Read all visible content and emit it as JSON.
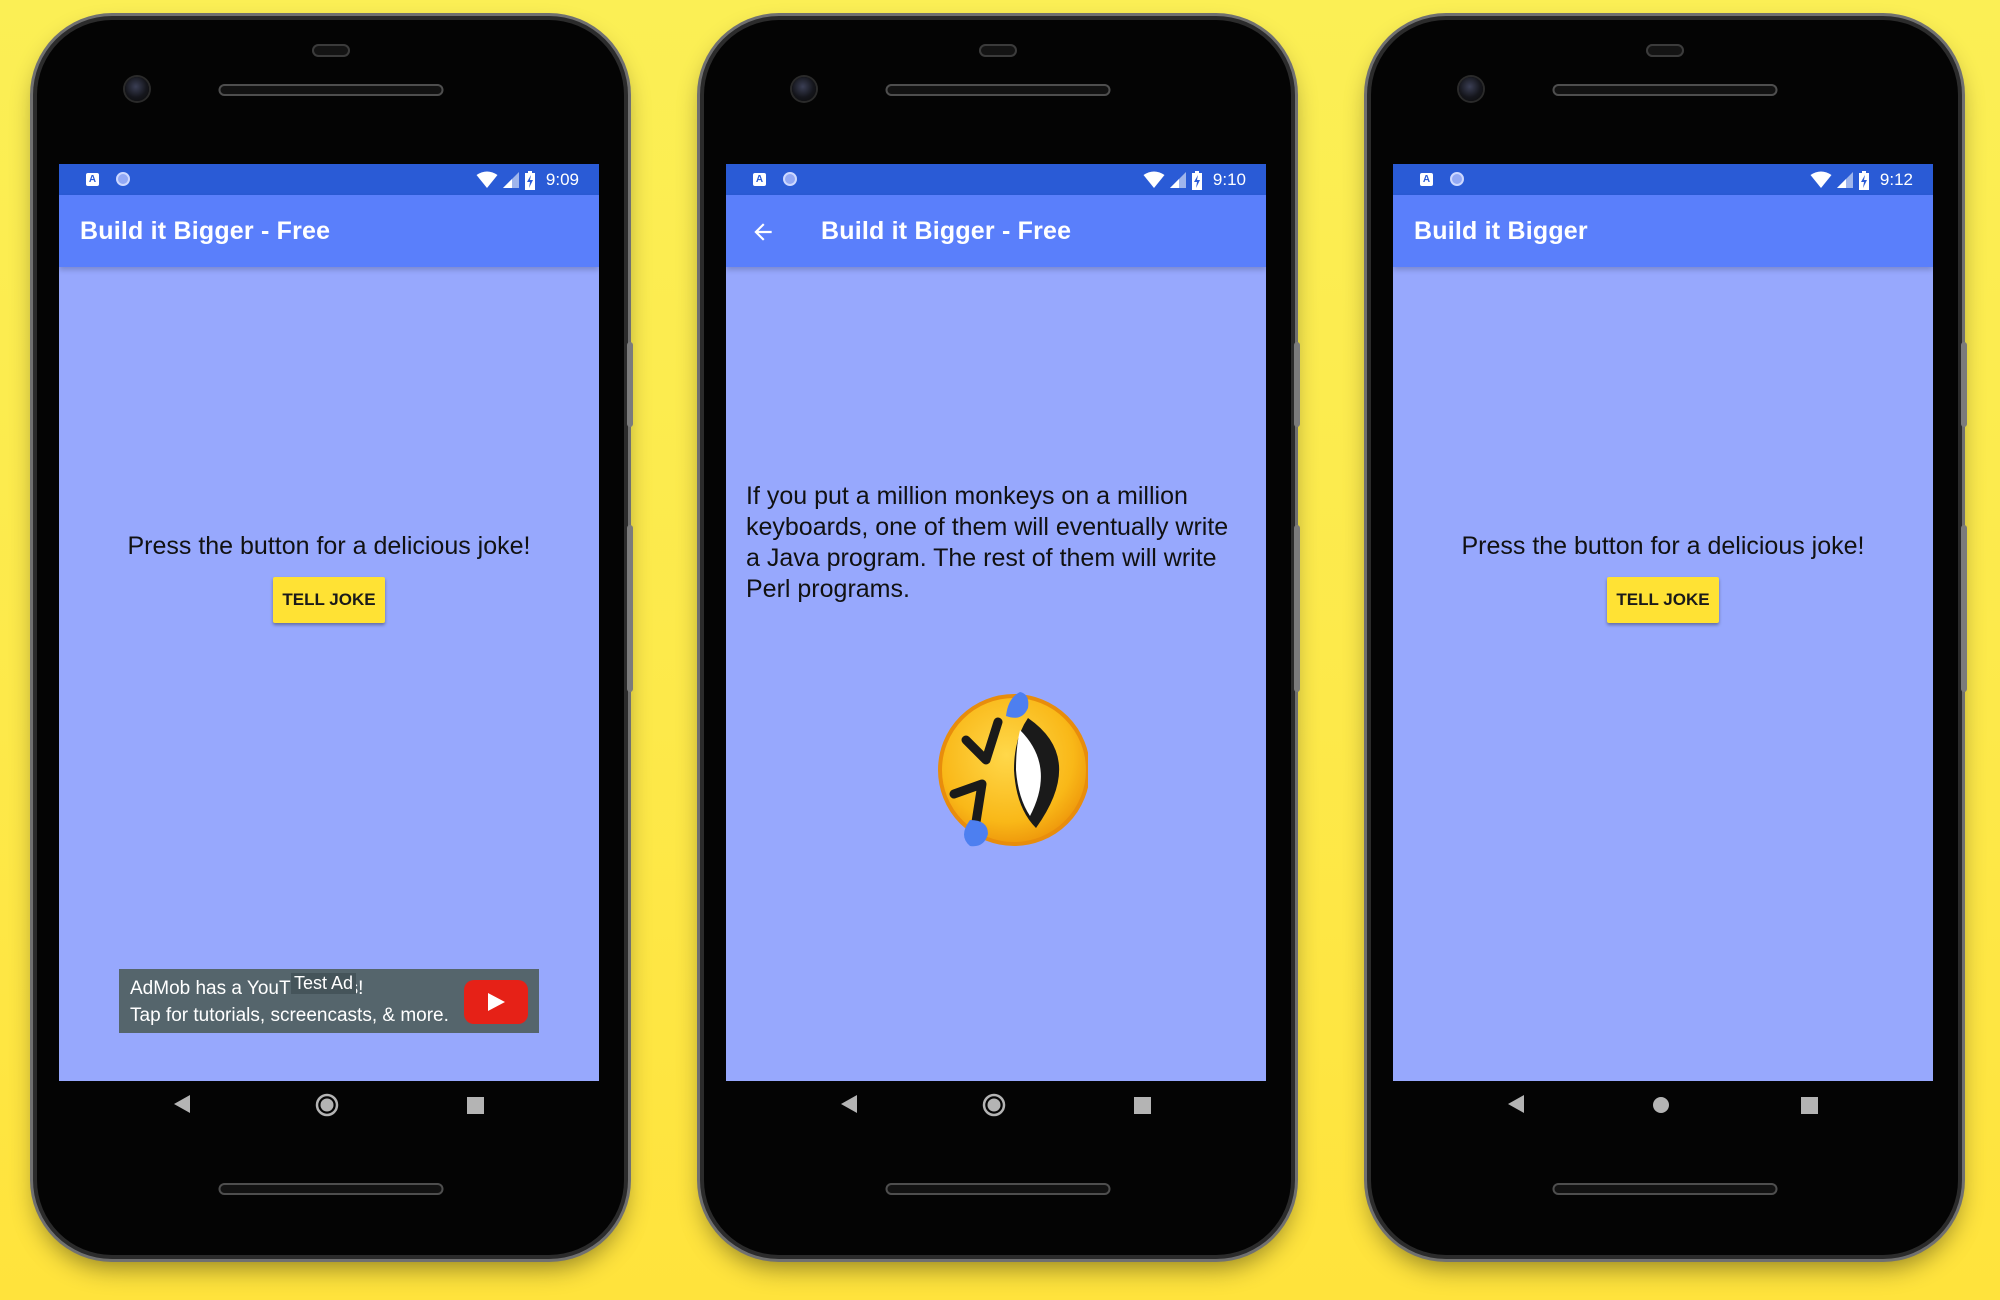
{
  "phones": [
    {
      "status": {
        "time": "9:09",
        "notif_icon": "A"
      },
      "appbar": {
        "title": "Build it Bigger - Free",
        "has_back": false
      },
      "main": {
        "prompt": "Press the button for a delicious joke!",
        "button_label": "TELL JOKE"
      },
      "ad": {
        "line1": "AdMob has a YouTube series!",
        "line1_visible_start": "AdMob has a YouT",
        "line1_visible_end": "s!",
        "line2": "Tap for tutorials, screencasts, & more.",
        "badge": "Test Ad"
      }
    },
    {
      "status": {
        "time": "9:10",
        "notif_icon": "A"
      },
      "appbar": {
        "title": "Build it Bigger - Free",
        "has_back": true
      },
      "main": {
        "joke": "If you put a million monkeys on a million keyboards, one of them will eventually write a Java program. The rest of them will write Perl programs.",
        "emoji": "rolling-on-floor-laughing-emoji"
      }
    },
    {
      "status": {
        "time": "9:12",
        "notif_icon": "A"
      },
      "appbar": {
        "title": "Build it Bigger",
        "has_back": false
      },
      "main": {
        "prompt": "Press the button for a delicious joke!",
        "button_label": "TELL JOKE"
      }
    }
  ],
  "colors": {
    "background": "#fde94a",
    "status_bar": "#2a5bd6",
    "app_bar": "#5a7ffb",
    "screen": "#97a8fd",
    "button": "#ffe234",
    "ad_bg": "#55656c",
    "youtube_red": "#e62117"
  },
  "navigation_icons": [
    "back-triangle-icon",
    "home-circle-icon",
    "recents-square-icon"
  ]
}
